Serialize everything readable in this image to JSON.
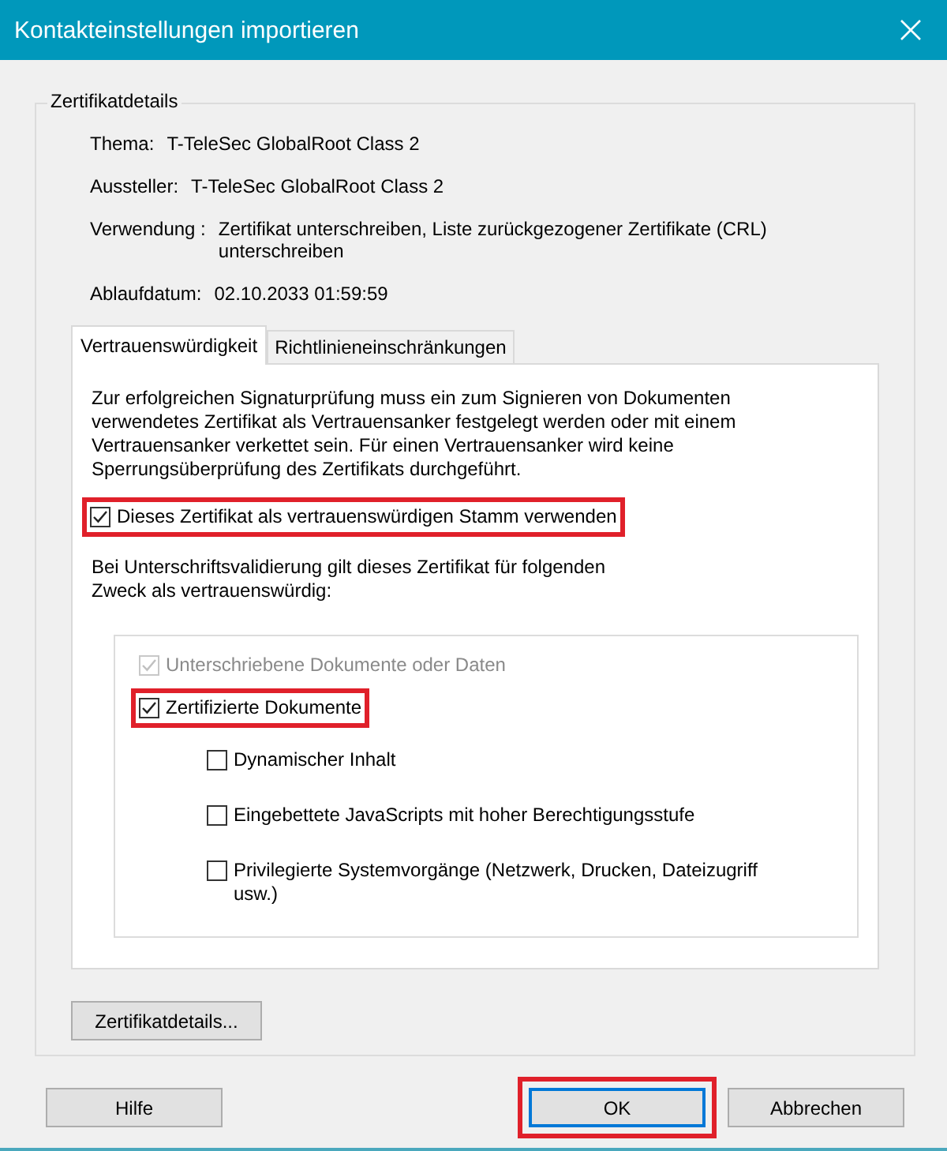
{
  "window": {
    "title": "Kontakteinstellungen importieren"
  },
  "details": {
    "legend": "Zertifikatdetails",
    "fields": [
      {
        "label": "Thema:",
        "value": "T-TeleSec GlobalRoot Class 2"
      },
      {
        "label": "Aussteller:",
        "value": "T-TeleSec GlobalRoot Class 2"
      },
      {
        "label": "Verwendung :",
        "value": "Zertifikat unterschreiben, Liste zurückgezogener Zertifikate (CRL) unterschreiben"
      },
      {
        "label": "Ablaufdatum:",
        "value": "02.10.2033 01:59:59"
      }
    ]
  },
  "tabs": [
    {
      "label": "Vertrauenswürdigkeit",
      "selected": true
    },
    {
      "label": "Richtlinieneinschränkungen",
      "selected": false
    }
  ],
  "trust": {
    "description": "Zur erfolgreichen Signaturprüfung muss ein zum Signieren von Dokumenten verwendetes Zertifikat als Vertrauensanker festgelegt werden oder mit einem Vertrauensanker verkettet sein. Für einen Vertrauensanker wird keine Sperrungsüberprüfung des Zertifikats durchgeführt.",
    "root_checkbox": {
      "label": "Dieses Zertifikat als vertrauenswürdigen Stamm verwenden",
      "checked": true,
      "disabled": false,
      "highlighted": true
    },
    "purpose_text": "Bei Unterschriftsvalidierung gilt dieses Zertifikat für folgenden Zweck als vertrauenswürdig:",
    "purposes": [
      {
        "label": "Unterschriebene Dokumente oder Daten",
        "checked": true,
        "disabled": true,
        "highlighted": false
      },
      {
        "label": "Zertifizierte Dokumente",
        "checked": true,
        "disabled": false,
        "highlighted": true,
        "children": [
          {
            "label": "Dynamischer Inhalt",
            "checked": false,
            "disabled": false,
            "highlighted": false
          },
          {
            "label": "Eingebettete JavaScripts mit hoher Berechtigungsstufe",
            "checked": false,
            "disabled": false,
            "highlighted": false
          },
          {
            "label": "Privilegierte Systemvorgänge (Netzwerk, Drucken, Dateizugriff usw.)",
            "checked": false,
            "disabled": false,
            "highlighted": false
          }
        ]
      }
    ]
  },
  "details_button": {
    "label": "Zertifikatdetails..."
  },
  "buttons": [
    {
      "label": "Hilfe",
      "kind": "help",
      "highlighted": false
    },
    {
      "label": "OK",
      "kind": "default",
      "highlighted": true
    },
    {
      "label": "Abbrechen",
      "kind": "cancel",
      "highlighted": false
    }
  ]
}
